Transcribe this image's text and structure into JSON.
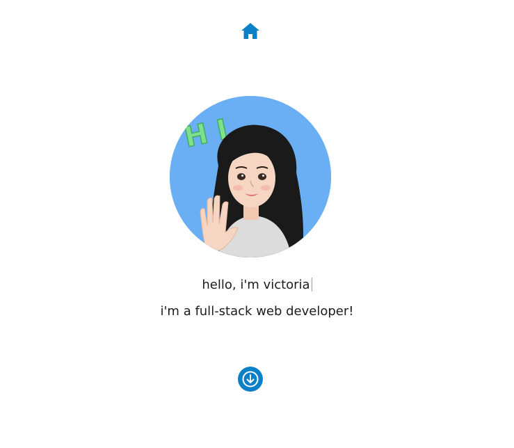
{
  "nav": {
    "home_icon": "home-icon",
    "scroll_icon": "arrow-down-circle-icon"
  },
  "hero": {
    "avatar_badge_text": "HI",
    "greeting": "hello, i'm victoria",
    "subtitle": "i'm a full-stack web developer!"
  },
  "colors": {
    "accent": "#0b80c6",
    "avatar_bg": "#6aaef4",
    "badge_green": "#7fe08f"
  }
}
